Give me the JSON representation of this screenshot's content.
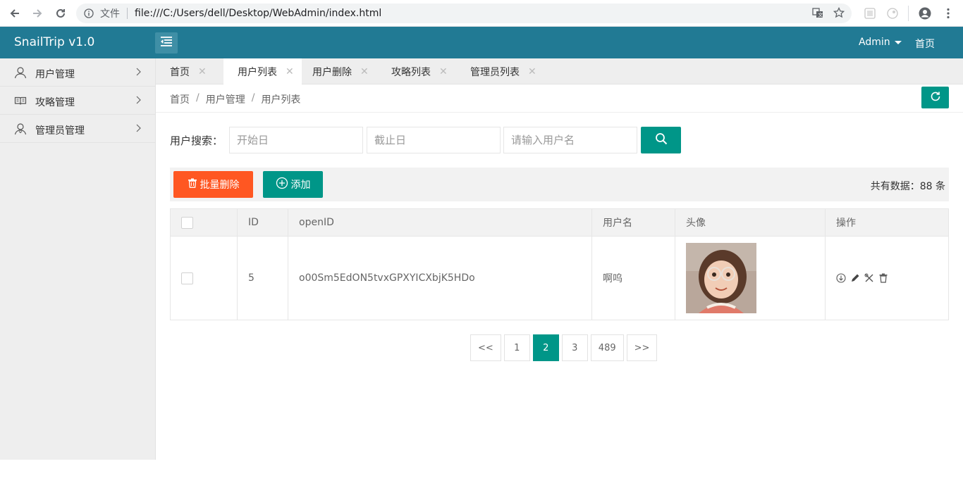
{
  "browser": {
    "security_label": "文件",
    "url": "file:///C:/Users/dell/Desktop/WebAdmin/index.html",
    "icons": [
      "back-arrow-icon",
      "forward-arrow-icon",
      "reload-icon",
      "info-icon",
      "translate-icon",
      "star-icon",
      "extension-icon",
      "extension-icon",
      "profile-icon",
      "menu-icon"
    ]
  },
  "header": {
    "logo": "SnailTrip v1.0",
    "user": "Admin",
    "home": "首页"
  },
  "sidebar": {
    "items": [
      {
        "label": "用户管理",
        "icon": "user-icon"
      },
      {
        "label": "攻略管理",
        "icon": "book-icon"
      },
      {
        "label": "管理员管理",
        "icon": "admin-user-icon"
      }
    ]
  },
  "tabs": [
    {
      "label": "首页",
      "active": false
    },
    {
      "label": "用户列表",
      "active": true
    },
    {
      "label": "用户删除",
      "active": false
    },
    {
      "label": "攻略列表",
      "active": false
    },
    {
      "label": "管理员列表",
      "active": false
    }
  ],
  "breadcrumb": [
    "首页",
    "用户管理",
    "用户列表"
  ],
  "search": {
    "label": "用户搜索：",
    "start_placeholder": "开始日",
    "end_placeholder": "截止日",
    "name_placeholder": "请输入用户名"
  },
  "actions": {
    "batch_delete": "批量删除",
    "add": "添加",
    "total": "共有数据：88 条"
  },
  "table": {
    "headers": [
      "",
      "ID",
      "openID",
      "用户名",
      "头像",
      "操作"
    ],
    "rows": [
      {
        "id": "5",
        "openid": "o00Sm5EdON5tvxGPXYICXbjK5HDo",
        "username": "啊呜",
        "avatar": "avatar-photo"
      }
    ]
  },
  "pagination": [
    "<<",
    "1",
    "2",
    "3",
    "489",
    ">>"
  ],
  "pagination_active": "2",
  "colors": {
    "header": "#217a94",
    "primary": "#009688",
    "danger": "#ff5722"
  }
}
